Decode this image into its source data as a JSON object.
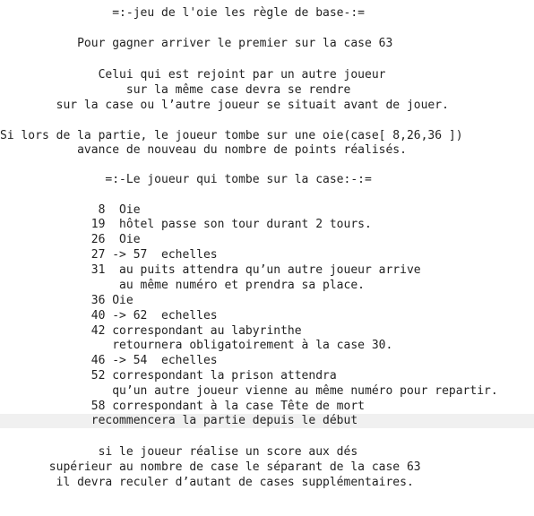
{
  "document": {
    "lines": [
      "                =:-jeu de l'oie les règle de base-:=",
      "           Pour gagner arriver le premier sur la case 63",
      "              Celui qui est rejoint par un autre joueur",
      "                  sur la même case devra se rendre",
      "        sur la case ou l’autre joueur se situait avant de jouer.",
      "Si lors de la partie, le joueur tombe sur une oie(case[ 8,26,36 ])",
      "           avance de nouveau du nombre de points réalisés.",
      "               =:-Le joueur qui tombe sur la case:-:=",
      "              8  Oie",
      "             19  hôtel passe son tour durant 2 tours.",
      "             26  Oie",
      "             27 -> 57  echelles",
      "             31  au puits attendra qu’un autre joueur arrive",
      "                 au même numéro et prendra sa place.",
      "             36 Oie",
      "             40 -> 62  echelles",
      "             42 correspondant au labyrinthe",
      "                retournera obligatoirement à la case 30.",
      "             46 -> 54  echelles",
      "             52 correspondant la prison attendra",
      "                qu’un autre joueur vienne au même numéro pour repartir.",
      "             58 correspondant à la case Tête de mort",
      "             recommencera la partie depuis le début",
      "              si le joueur réalise un score aux dés",
      "       supérieur au nombre de case le séparant de la case 63",
      "        il devra reculer d’autant de cases supplémentaires."
    ]
  }
}
